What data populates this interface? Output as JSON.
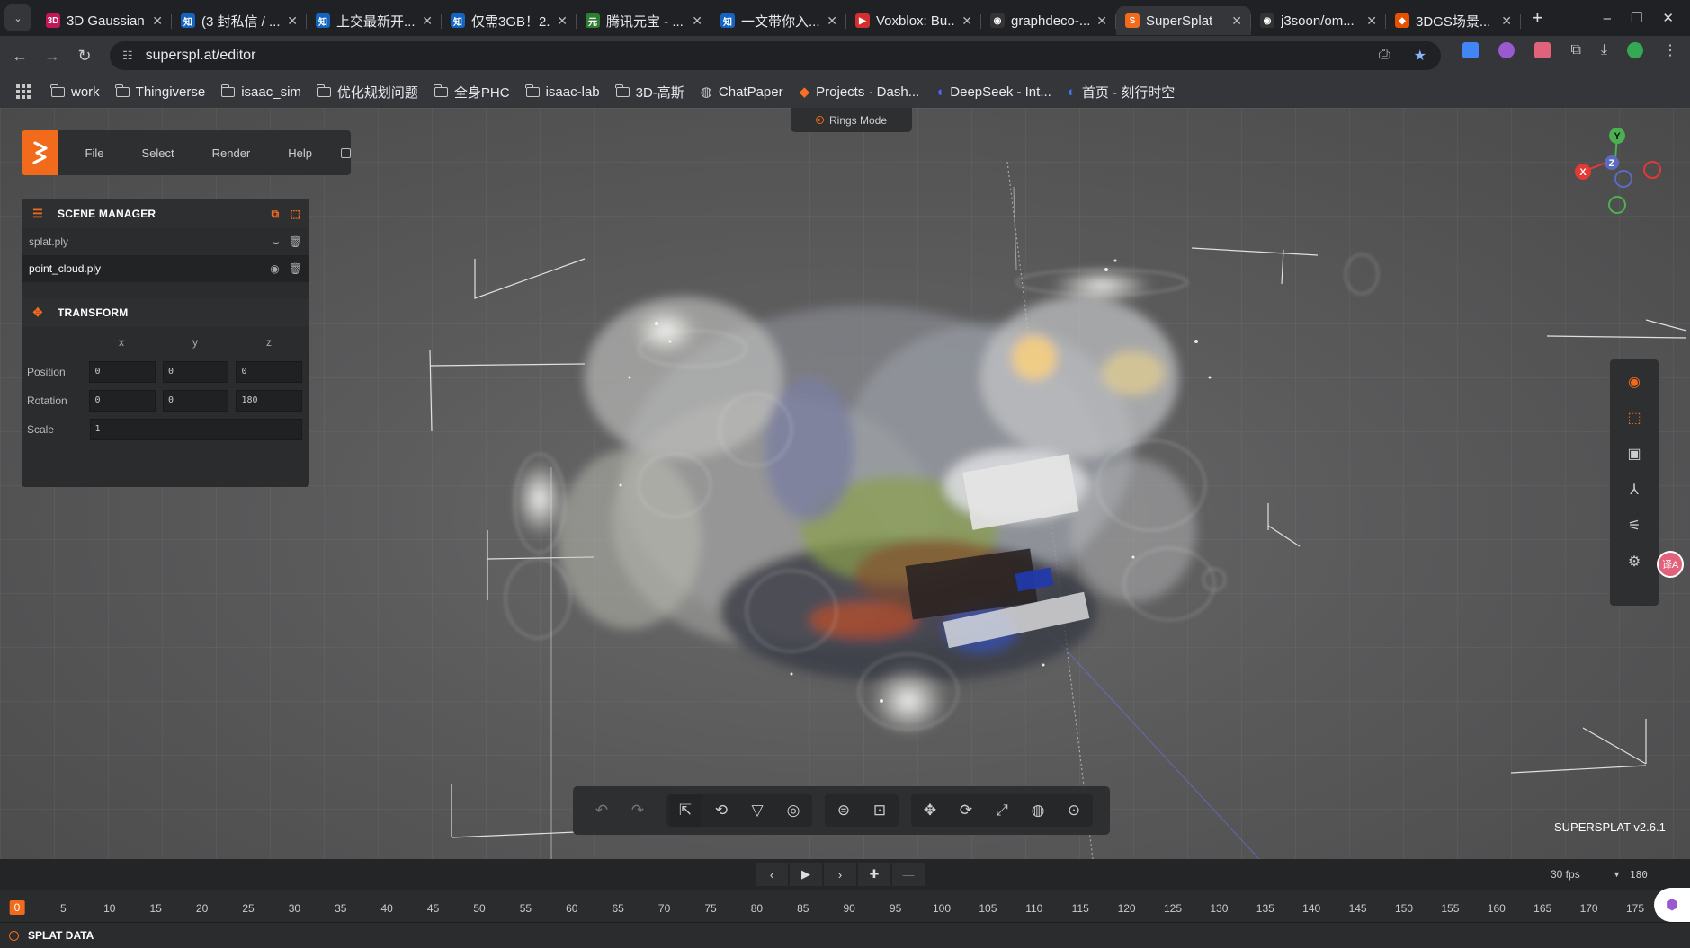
{
  "browser": {
    "tabs": [
      {
        "label": "3D Gaussian",
        "fav_bg": "#c2185b",
        "fav": "3D"
      },
      {
        "label": "(3 封私信 / ...",
        "fav_bg": "#1565c0",
        "fav": "知"
      },
      {
        "label": "上交最新开...",
        "fav_bg": "#1565c0",
        "fav": "知"
      },
      {
        "label": "仅需3GB！2...",
        "fav_bg": "#1565c0",
        "fav": "知"
      },
      {
        "label": "腾讯元宝 - ...",
        "fav_bg": "#2e7d32",
        "fav": "元"
      },
      {
        "label": "一文带你入...",
        "fav_bg": "#1565c0",
        "fav": "知"
      },
      {
        "label": "Voxblox: Bu...",
        "fav_bg": "#d32f2f",
        "fav": "▶"
      },
      {
        "label": "graphdeco-...",
        "fav_bg": "#333333",
        "fav": "◉"
      },
      {
        "label": "SuperSplat",
        "fav_bg": "#f26a1b",
        "fav": "S"
      },
      {
        "label": "j3soon/om...",
        "fav_bg": "#333333",
        "fav": "◉"
      },
      {
        "label": "3DGS场景...",
        "fav_bg": "#e65100",
        "fav": "◆"
      }
    ],
    "active_tab_index": 8,
    "url": "superspl.at/editor",
    "bookmarks": [
      {
        "label": "work",
        "icon": "folder-icon"
      },
      {
        "label": "Thingiverse",
        "icon": "folder-icon"
      },
      {
        "label": "isaac_sim",
        "icon": "folder-icon"
      },
      {
        "label": "优化规划问题",
        "icon": "folder-icon"
      },
      {
        "label": "全身PHC",
        "icon": "folder-icon"
      },
      {
        "label": "isaac-lab",
        "icon": "folder-icon"
      },
      {
        "label": "3D-高斯",
        "icon": "folder-icon"
      },
      {
        "label": "ChatPaper",
        "icon": "globe-icon"
      },
      {
        "label": "Projects · Dash...",
        "icon": "gitlab-icon"
      },
      {
        "label": "DeepSeek - Int...",
        "icon": "deepseek-icon"
      },
      {
        "label": "首页 - 刻行时空",
        "icon": "site-icon"
      }
    ]
  },
  "app": {
    "menu": {
      "file": "File",
      "select": "Select",
      "render": "Render",
      "help": "Help"
    },
    "rings_mode": "Rings Mode",
    "scene_manager": {
      "title": "SCENE MANAGER",
      "items": [
        {
          "name": "splat.ply",
          "visible": false
        },
        {
          "name": "point_cloud.ply",
          "visible": true,
          "selected": true
        }
      ]
    },
    "transform": {
      "title": "TRANSFORM",
      "axes": [
        "x",
        "y",
        "z"
      ],
      "position_label": "Position",
      "position": [
        "0",
        "0",
        "0"
      ],
      "rotation_label": "Rotation",
      "rotation": [
        "0",
        "0",
        "180"
      ],
      "scale_label": "Scale",
      "scale": "1"
    },
    "gizmo": {
      "x": "X",
      "y": "Y",
      "z": "Z"
    },
    "version": "SUPERSPLAT v2.6.1",
    "timeline": {
      "fps": "30 fps",
      "frames": "180",
      "current_frame": "0",
      "ticks": [
        "0",
        "5",
        "10",
        "15",
        "20",
        "25",
        "30",
        "35",
        "40",
        "45",
        "50",
        "55",
        "60",
        "65",
        "70",
        "75",
        "80",
        "85",
        "90",
        "95",
        "100",
        "105",
        "110",
        "115",
        "120",
        "125",
        "130",
        "135",
        "140",
        "145",
        "150",
        "155",
        "160",
        "165",
        "170",
        "175"
      ]
    },
    "splat_data_label": "SPLAT DATA",
    "accent_color": "#f26a1b"
  }
}
